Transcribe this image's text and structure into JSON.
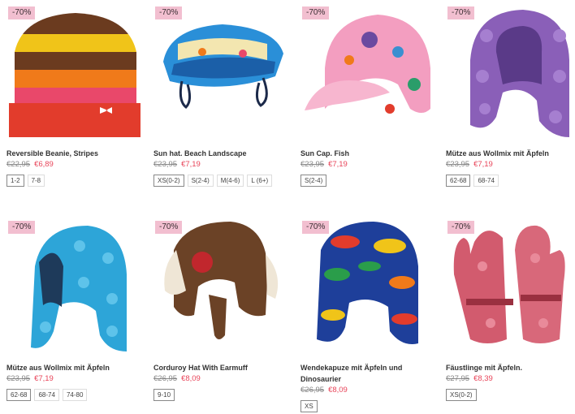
{
  "products": [
    {
      "badge": "-70%",
      "name": "Reversible Beanie, Stripes",
      "old_price": "€22,95",
      "new_price": "€6,89",
      "sizes": [
        "1-2",
        "7-8"
      ],
      "icon": "striped-beanie-icon"
    },
    {
      "badge": "-70%",
      "name": "Sun hat. Beach Landscape",
      "old_price": "€23,95",
      "new_price": "€7,19",
      "sizes": [
        "XS(0-2)",
        "S(2-4)",
        "M(4-6)",
        "L (6+)"
      ],
      "icon": "sun-hat-icon"
    },
    {
      "badge": "-70%",
      "name": "Sun Cap. Fish",
      "old_price": "€23,95",
      "new_price": "€7,19",
      "sizes": [
        "S(2-4)"
      ],
      "icon": "sun-cap-icon"
    },
    {
      "badge": "-70%",
      "name": "Mütze aus Wollmix mit Äpfeln",
      "old_price": "€23,95",
      "new_price": "€7,19",
      "sizes": [
        "62-68",
        "68-74"
      ],
      "icon": "wool-hat-purple-icon"
    },
    {
      "badge": "-70%",
      "name": "Mütze aus Wollmix mit Äpfeln",
      "old_price": "€23,95",
      "new_price": "€7,19",
      "sizes": [
        "62-68",
        "68-74",
        "74-80"
      ],
      "icon": "wool-hat-blue-icon"
    },
    {
      "badge": "-70%",
      "name": "Corduroy Hat With Earmuff",
      "old_price": "€26,95",
      "new_price": "€8,09",
      "sizes": [
        "9-10"
      ],
      "icon": "corduroy-hat-icon"
    },
    {
      "badge": "-70%",
      "name": "Wendekapuze mit Äpfeln und Dinosaurier",
      "old_price": "€26,95",
      "new_price": "€8,09",
      "sizes": [
        "XS"
      ],
      "icon": "dino-hood-icon"
    },
    {
      "badge": "-70%",
      "name": "Fäustlinge mit Äpfeln.",
      "old_price": "€27,95",
      "new_price": "€8,39",
      "sizes": [
        "XS(0-2)"
      ],
      "icon": "mittens-icon"
    }
  ]
}
